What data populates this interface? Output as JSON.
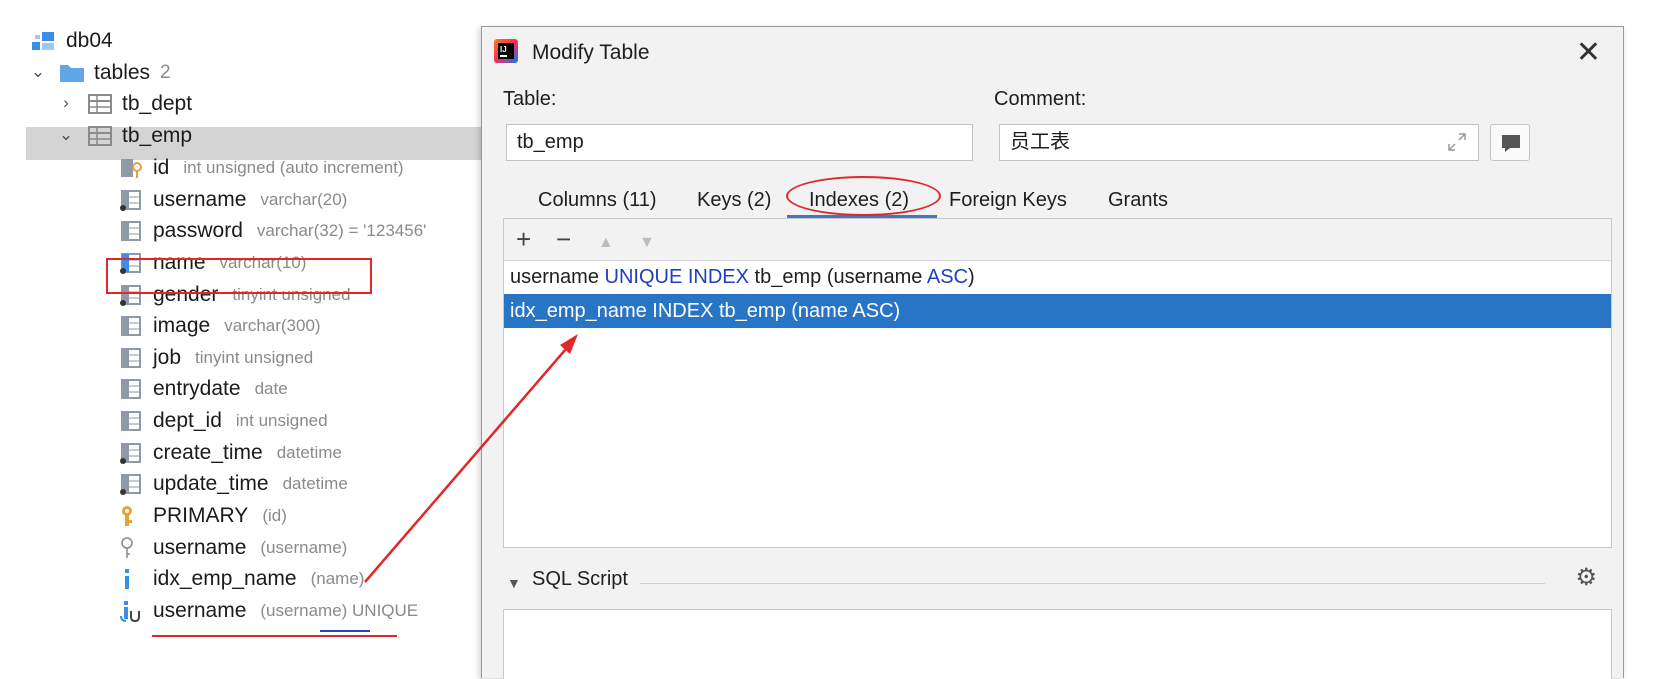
{
  "tree": {
    "db": {
      "label": "db04",
      "icon": "database-schema-icon"
    },
    "tables": {
      "label": "tables",
      "count": "2",
      "icon": "folder-icon"
    },
    "tb_dept": {
      "label": "tb_dept",
      "icon": "table-icon"
    },
    "tb_emp": {
      "label": "tb_emp",
      "icon": "table-icon"
    },
    "columns": [
      {
        "name": "id",
        "type": "int unsigned (auto increment)",
        "icon": "primary-key-column-icon"
      },
      {
        "name": "username",
        "type": "varchar(20)",
        "icon": "not-null-column-icon"
      },
      {
        "name": "password",
        "type": "varchar(32) = '123456'",
        "icon": "column-icon"
      },
      {
        "name": "name",
        "type": "varchar(10)",
        "icon": "indexed-column-icon"
      },
      {
        "name": "gender",
        "type": "tinyint unsigned",
        "icon": "not-null-column-icon"
      },
      {
        "name": "image",
        "type": "varchar(300)",
        "icon": "column-icon"
      },
      {
        "name": "job",
        "type": "tinyint unsigned",
        "icon": "column-icon"
      },
      {
        "name": "entrydate",
        "type": "date",
        "icon": "column-icon"
      },
      {
        "name": "dept_id",
        "type": "int unsigned",
        "icon": "column-icon"
      },
      {
        "name": "create_time",
        "type": "datetime",
        "icon": "not-null-column-icon"
      },
      {
        "name": "update_time",
        "type": "datetime",
        "icon": "not-null-column-icon"
      }
    ],
    "keys": [
      {
        "name": "PRIMARY",
        "detail": "(id)",
        "icon": "primary-key-icon"
      },
      {
        "name": "username",
        "detail": "(username)",
        "icon": "unique-key-icon"
      }
    ],
    "indexes": [
      {
        "name": "idx_emp_name",
        "detail": "(name)",
        "icon": "index-icon"
      },
      {
        "name": "username",
        "detail": "(username) UNIQUE",
        "icon": "unique-index-icon"
      }
    ]
  },
  "dialog": {
    "title": "Modify Table",
    "app_icon": "intellij-app-icon",
    "close_glyph": "✕",
    "table_label": "Table:",
    "table_value": "tb_emp",
    "comment_label": "Comment:",
    "comment_value": "员工表",
    "tabs": [
      "Columns (11)",
      "Keys (2)",
      "Indexes (2)",
      "Foreign Keys",
      "Grants"
    ],
    "active_tab": "Indexes (2)",
    "toolbar": {
      "add": "+",
      "remove": "−",
      "up": "▲",
      "down": "▼"
    },
    "index_rows": [
      {
        "name": "username",
        "kw1": "UNIQUE INDEX",
        "table": "tb_emp",
        "col": "(username",
        "kw2": "ASC",
        "end": ")"
      },
      {
        "text": "idx_emp_name INDEX tb_emp (name ASC)"
      }
    ],
    "sql_script_label": "SQL Script"
  },
  "colors": {
    "selection_blue": "#2874c5",
    "keyword_blue": "#1f3fbf",
    "annotation_red": "#e0282a",
    "tab_underline": "#3d78c6"
  }
}
